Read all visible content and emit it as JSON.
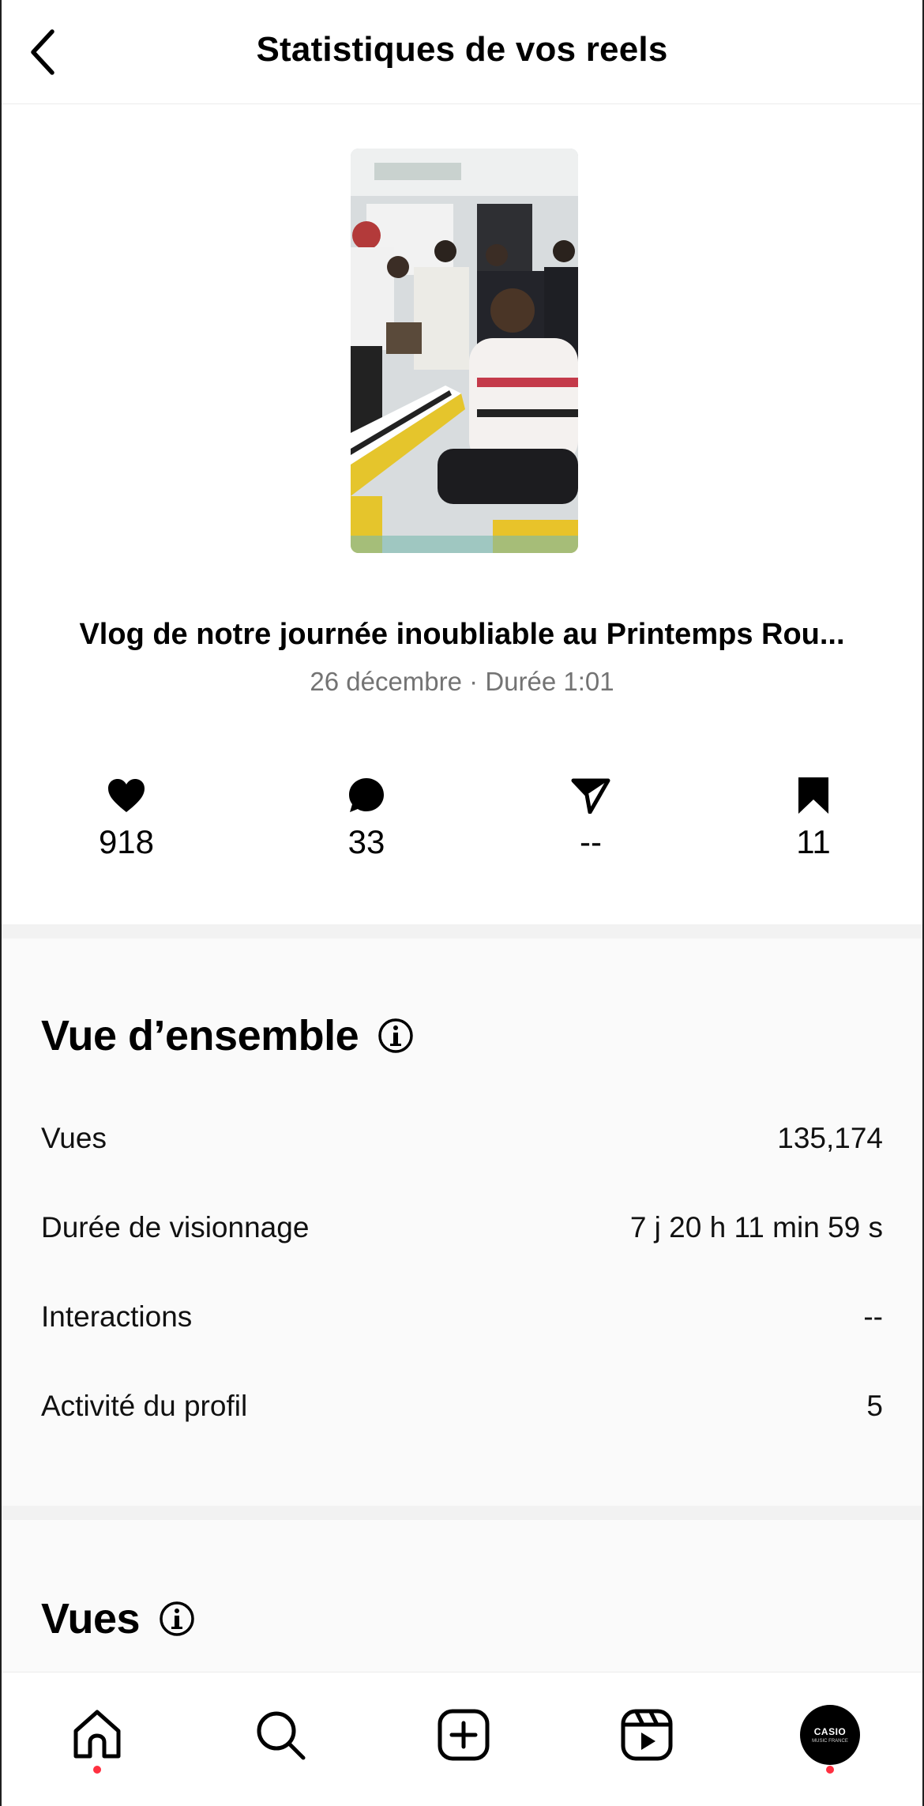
{
  "header": {
    "title": "Statistiques de vos reels",
    "back_icon": "chevron-left-icon"
  },
  "reel": {
    "title": "Vlog de notre journée inoubliable au Printemps Rou...",
    "meta": "26 décembre · Durée 1:01"
  },
  "engagement": [
    {
      "icon": "heart-icon",
      "value": "918"
    },
    {
      "icon": "comment-icon",
      "value": "33"
    },
    {
      "icon": "share-icon",
      "value": "--"
    },
    {
      "icon": "bookmark-icon",
      "value": "11"
    }
  ],
  "overview": {
    "title": "Vue d’ensemble",
    "rows": [
      {
        "label": "Vues",
        "value": "135,174"
      },
      {
        "label": "Durée de visionnage",
        "value": "7 j 20 h 11 min 59 s"
      },
      {
        "label": "Interactions",
        "value": "--"
      },
      {
        "label": "Activité du profil",
        "value": "5"
      }
    ]
  },
  "views_section": {
    "title": "Vues"
  },
  "bottom_nav": {
    "items": [
      "home-icon",
      "search-icon",
      "create-icon",
      "reels-icon",
      "profile-avatar"
    ],
    "avatar_brand": "CASIO",
    "avatar_sub": "MUSIC FRANCE",
    "dot_color": "#ff3040"
  }
}
